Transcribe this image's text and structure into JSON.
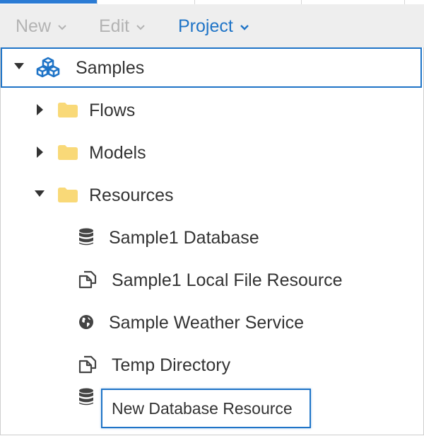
{
  "menubar": {
    "new_label": "New",
    "edit_label": "Edit",
    "project_label": "Project"
  },
  "tree": {
    "root": {
      "label": "Samples",
      "icon": "cubes-icon",
      "expanded": true
    },
    "folders": [
      {
        "label": "Flows",
        "icon": "folder-icon",
        "expanded": false
      },
      {
        "label": "Models",
        "icon": "folder-icon",
        "expanded": false
      },
      {
        "label": "Resources",
        "icon": "folder-icon",
        "expanded": true
      }
    ],
    "resources": [
      {
        "label": "Sample1 Database",
        "icon": "database-icon"
      },
      {
        "label": "Sample1 Local File Resource",
        "icon": "files-icon"
      },
      {
        "label": "Sample Weather Service",
        "icon": "globe-icon"
      },
      {
        "label": "Temp Directory",
        "icon": "files-icon"
      }
    ],
    "new_item": {
      "icon": "database-icon",
      "value": "New Database Resource"
    }
  },
  "colors": {
    "accent": "#1f74c7",
    "folder": "#f9d978",
    "disabled": "#b3b3b3",
    "menubar_bg": "#eeeeee"
  }
}
